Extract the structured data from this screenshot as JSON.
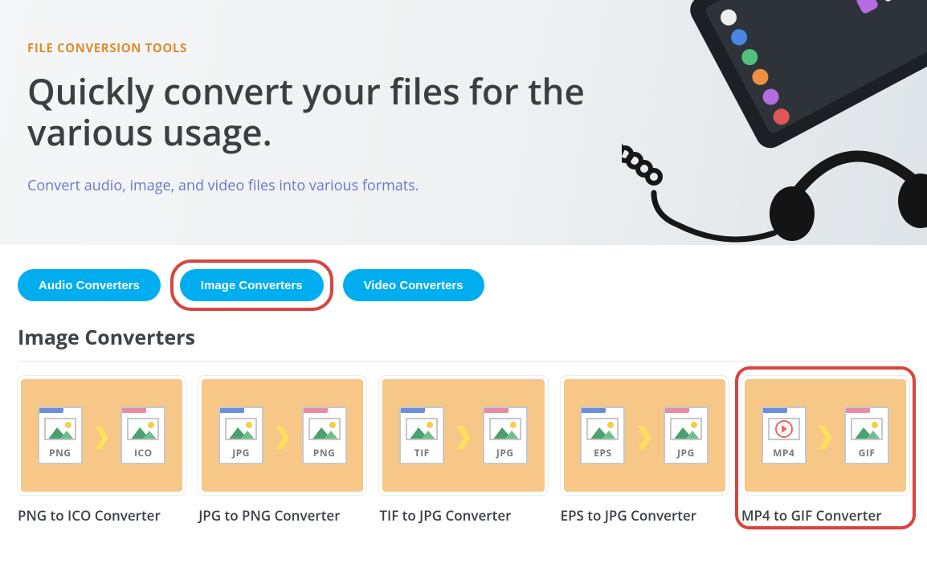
{
  "hero": {
    "eyebrow": "FILE CONVERSION TOOLS",
    "title": "Quickly convert your files for the various usage.",
    "subtitle": "Convert audio, image, and video files into various formats."
  },
  "tabs": {
    "items": [
      {
        "label": "Audio Converters",
        "highlighted": false
      },
      {
        "label": "Image Converters",
        "highlighted": true
      },
      {
        "label": "Video Converters",
        "highlighted": false
      }
    ]
  },
  "section": {
    "title": "Image Converters"
  },
  "cards": [
    {
      "from": "PNG",
      "to": "ICO",
      "label": "PNG to ICO Converter",
      "from_tab": "blue",
      "to_tab": "pink",
      "from_kind": "img",
      "to_kind": "img",
      "highlighted": false
    },
    {
      "from": "JPG",
      "to": "PNG",
      "label": "JPG to PNG Converter",
      "from_tab": "blue",
      "to_tab": "pink",
      "from_kind": "img",
      "to_kind": "img",
      "highlighted": false
    },
    {
      "from": "TIF",
      "to": "JPG",
      "label": "TIF to JPG Converter",
      "from_tab": "blue",
      "to_tab": "pink",
      "from_kind": "img",
      "to_kind": "img",
      "highlighted": false
    },
    {
      "from": "EPS",
      "to": "JPG",
      "label": "EPS to JPG Converter",
      "from_tab": "blue",
      "to_tab": "pink",
      "from_kind": "img",
      "to_kind": "img",
      "highlighted": false
    },
    {
      "from": "MP4",
      "to": "GIF",
      "label": "MP4 to GIF Converter",
      "from_tab": "blue",
      "to_tab": "pink",
      "from_kind": "play",
      "to_kind": "img",
      "highlighted": true
    }
  ]
}
